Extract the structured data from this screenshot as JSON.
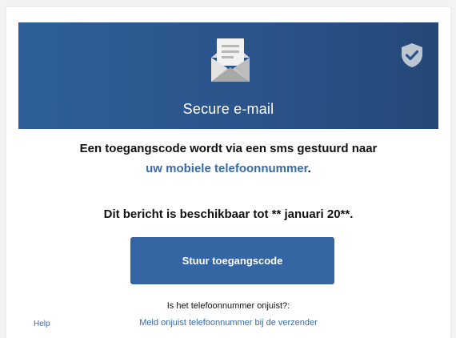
{
  "banner": {
    "title": "Secure e-mail",
    "icon": "envelope-open-icon",
    "badge_icon": "shield-check-icon",
    "colors": {
      "background": "#2e5f98",
      "text": "#ffffff"
    }
  },
  "message": {
    "line1": "Een toegangscode wordt via een sms gestuurd naar",
    "phone_link": "uw mobiele telefoonnummer",
    "phone_suffix": ".",
    "availability": "Dit bericht is beschikbaar tot ** januari 20**."
  },
  "actions": {
    "send_code_label": "Stuur toegangscode"
  },
  "footer": {
    "question": "Is het telefoonnummer onjuist?:",
    "help_label": "Help",
    "report_label": "Meld onjuist telefoonnummer bij de verzender"
  },
  "colors": {
    "accent": "#3565a2",
    "link": "#3a6aa4"
  }
}
